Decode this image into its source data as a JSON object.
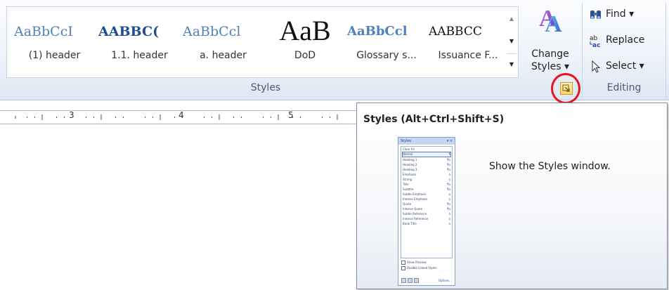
{
  "ribbon": {
    "styles_group": {
      "label": "Styles",
      "gallery": [
        {
          "sample": "AaBbCcI",
          "name": "(1) header"
        },
        {
          "sample": "AABBC(",
          "name": "1.1. header"
        },
        {
          "sample": "AaBbCcl",
          "name": "a. header"
        },
        {
          "sample": "AaB",
          "name": "DoD"
        },
        {
          "sample": "AaBbCcl",
          "name": "Glossary s..."
        },
        {
          "sample": "AABBCC",
          "name": "Issuance F..."
        }
      ],
      "gallery_scroll": {
        "up_icon": "▲",
        "down_icon": "▼",
        "more_icon": "▼"
      },
      "change_styles": {
        "line1": "Change",
        "line2": "Styles ▾"
      }
    },
    "editing_group": {
      "label": "Editing",
      "find": "Find ▾",
      "replace": "Replace",
      "select": "Select ▾"
    }
  },
  "ruler": {
    "numbers": [
      "3",
      "4",
      "5"
    ]
  },
  "tooltip": {
    "title": "Styles (Alt+Ctrl+Shift+S)",
    "description": "Show the Styles window.",
    "preview": {
      "title": "Styles",
      "close": "▾ ×",
      "items": [
        "Clear All",
        "Normal",
        "Heading 1",
        "Heading 2",
        "Heading 3",
        "Emphasis",
        "Strong",
        "Title",
        "Subtitle",
        "Subtle Emphasis",
        "Intense Emphasis",
        "Quote",
        "Intense Quote",
        "Subtle Reference",
        "Intense Reference",
        "Book Title"
      ],
      "markers": [
        "",
        "¶",
        "¶a",
        "¶a",
        "¶a",
        "a",
        "a",
        "¶a",
        "¶a",
        "a",
        "a",
        "¶a",
        "¶a",
        "a",
        "a",
        "a"
      ],
      "checks": [
        "Show Preview",
        "Disable Linked Styles"
      ],
      "options": "Options..."
    }
  },
  "colors": {
    "highlight_circle": "#e4161f",
    "launcher": "#ffd45c",
    "style_blue": "#4f81bd"
  }
}
